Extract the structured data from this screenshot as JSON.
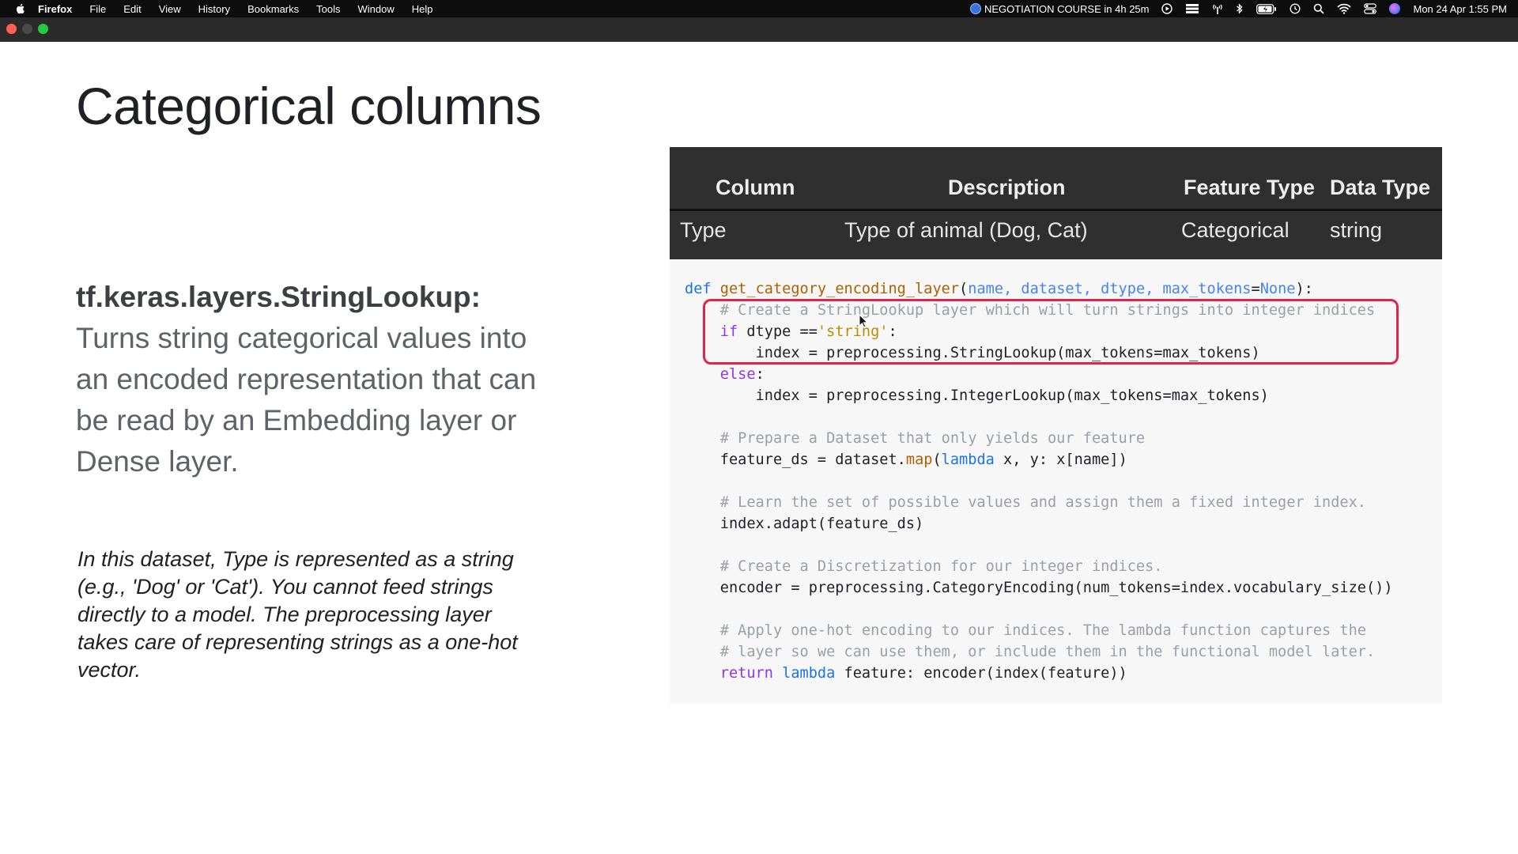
{
  "menubar": {
    "app": "Firefox",
    "items": [
      "File",
      "Edit",
      "View",
      "History",
      "Bookmarks",
      "Tools",
      "Window",
      "Help"
    ],
    "event": "NEGOTIATION COURSE in 4h 25m",
    "datetime": "Mon 24 Apr  1:55 PM"
  },
  "slide": {
    "title": "Categorical columns",
    "api_name": "tf.keras.layers.StringLookup:",
    "api_description": "Turns string categorical values into an encoded representation that can be read by an Embedding layer or Dense layer.",
    "note": "In this dataset, Type is represented as a string (e.g., 'Dog' or 'Cat'). You cannot feed strings directly to a model. The preprocessing layer takes care of representing strings as a one-hot vector."
  },
  "table": {
    "headers": [
      "Column",
      "Description",
      "Feature Type",
      "Data Type"
    ],
    "row": [
      "Type",
      "Type of animal (Dog, Cat)",
      "Categorical",
      "string"
    ]
  },
  "code": {
    "def": "def",
    "fn_name": "get_category_encoding_layer",
    "params": "name, dataset, dtype, max_tokens",
    "none": "None",
    "comment1": "# Create a StringLookup layer which will turn strings into integer indices",
    "if_kw": "if",
    "if_rest": " dtype ==",
    "string_lit": "'string'",
    "line_stringlookup": "index = preprocessing.StringLookup(max_tokens=max_tokens)",
    "else_kw": "else",
    "line_integerlookup": "index = preprocessing.IntegerLookup(max_tokens=max_tokens)",
    "comment2": "# Prepare a Dataset that only yields our feature",
    "feature_ds_a": "feature_ds = dataset.",
    "map": "map",
    "lambda": "lambda",
    "feature_ds_b": " x, y: x[name])",
    "comment3": "# Learn the set of possible values and assign them a fixed integer index.",
    "adapt": "index.adapt(feature_ds)",
    "comment4": "# Create a Discretization for our integer indices.",
    "encoder": "encoder = preprocessing.CategoryEncoding(num_tokens=index.vocabulary_size())",
    "comment5": "# Apply one-hot encoding to our indices. The lambda function captures the",
    "comment6": "# layer so we can use them, or include them in the functional model later.",
    "return_kw": "return",
    "return_rest": " feature: encoder(index(feature))"
  },
  "colors": {
    "highlight_border": "#e0244a",
    "keyword": "#1a73e8",
    "function": "#b06000",
    "comment": "#9aa0a6"
  }
}
